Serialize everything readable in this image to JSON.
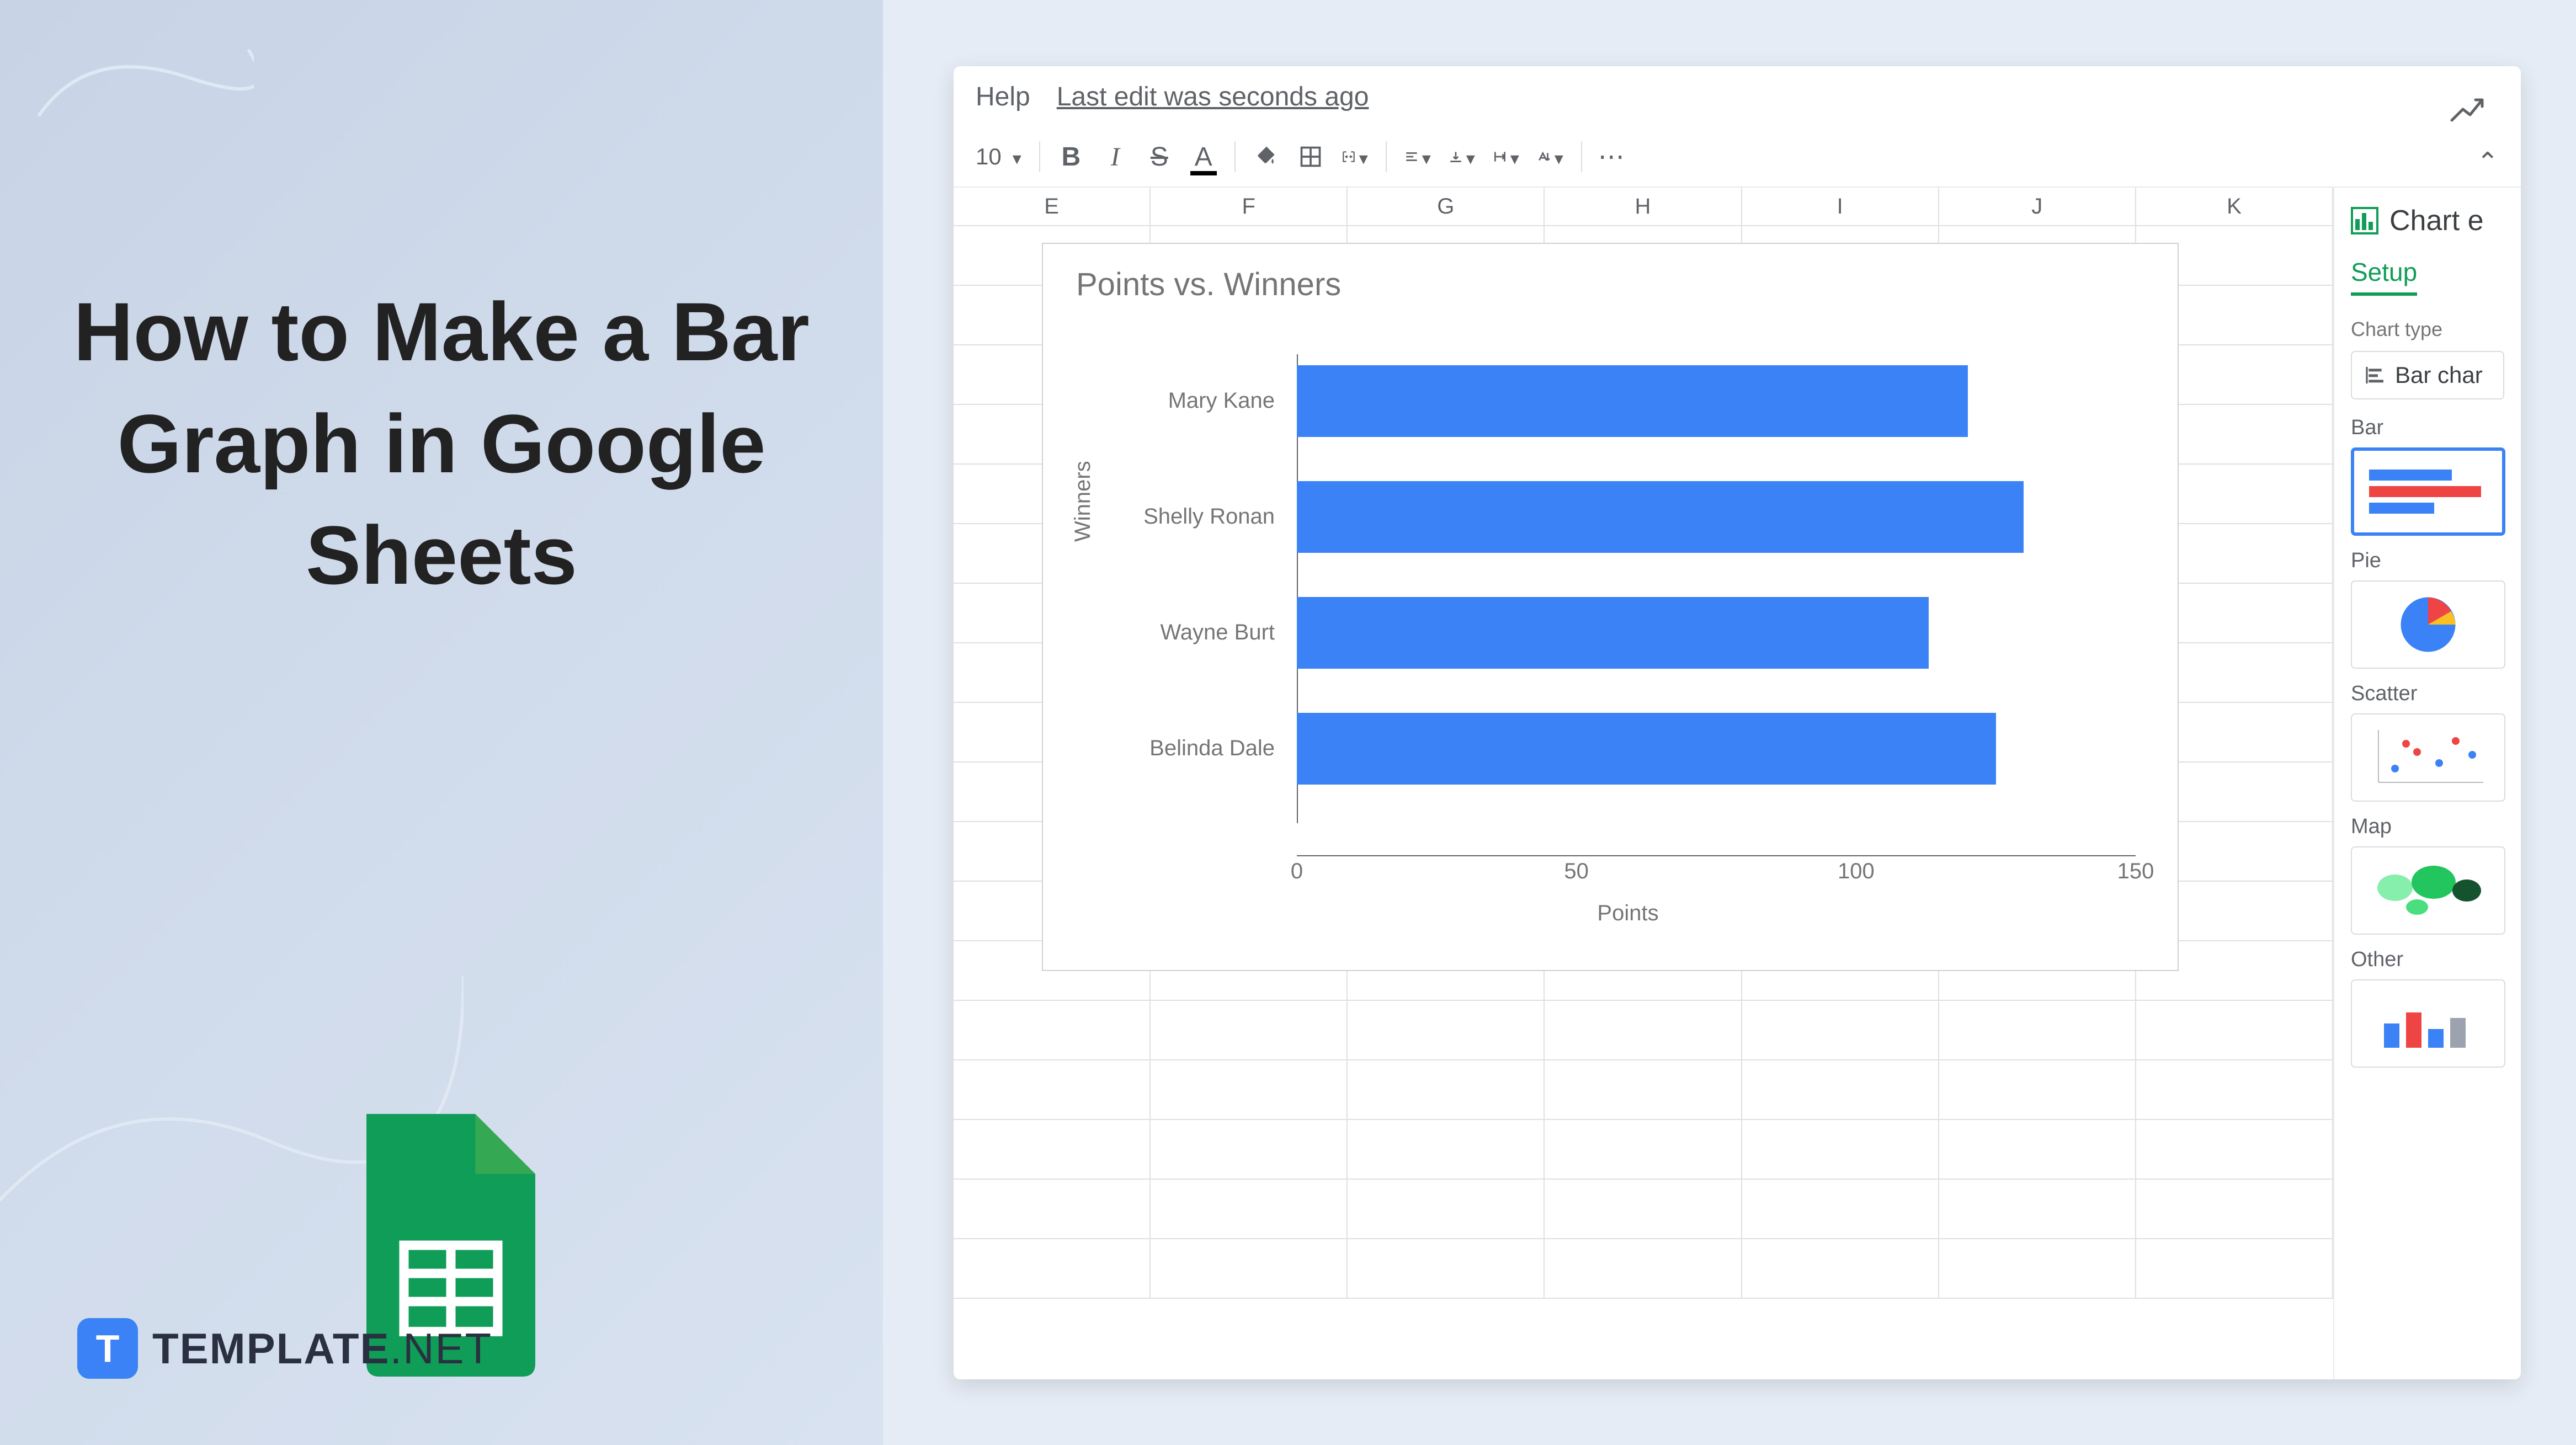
{
  "title": "How to Make a Bar Graph in Google Sheets",
  "brand": {
    "name": "TEMPLATE",
    "suffix": ".NET",
    "icon_letter": "T"
  },
  "menu": {
    "help": "Help",
    "last_edit": "Last edit was seconds ago"
  },
  "toolbar": {
    "font_size": "10"
  },
  "columns": [
    "E",
    "F",
    "G",
    "H",
    "I",
    "J",
    "K"
  ],
  "chart_panel": {
    "title": "Chart e",
    "tab": "Setup",
    "chart_type_label": "Chart type",
    "selector": "Bar char",
    "sections": {
      "bar": "Bar",
      "pie": "Pie",
      "scatter": "Scatter",
      "map": "Map",
      "other": "Other"
    }
  },
  "chart_data": {
    "type": "bar",
    "orientation": "horizontal",
    "title": "Points vs. Winners",
    "xlabel": "Points",
    "ylabel": "Winners",
    "xlim": [
      0,
      150
    ],
    "ticks": [
      0,
      50,
      100,
      150
    ],
    "categories": [
      "Mary Kane",
      "Shelly Ronan",
      "Wayne Burt",
      "Belinda Dale"
    ],
    "values": [
      120,
      130,
      113,
      125
    ],
    "bar_color": "#3b82f6"
  }
}
